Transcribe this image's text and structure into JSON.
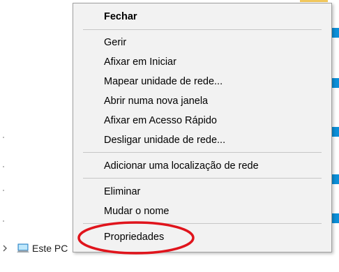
{
  "context_menu": {
    "items": [
      {
        "label": "Fechar",
        "bold": true
      },
      {
        "label": "Gerir"
      },
      {
        "label": "Afixar em Iniciar"
      },
      {
        "label": "Mapear unidade de rede..."
      },
      {
        "label": "Abrir numa nova janela"
      },
      {
        "label": "Afixar em Acesso Rápido"
      },
      {
        "label": "Desligar unidade de rede..."
      },
      {
        "label": "Adicionar uma localização de rede"
      },
      {
        "label": "Eliminar"
      },
      {
        "label": "Mudar o nome"
      },
      {
        "label": "Propriedades"
      }
    ]
  },
  "nav_tree": {
    "item_label": "Este PC"
  },
  "colors": {
    "annotation_ring": "#e0141c",
    "menu_background": "#f2f2f2",
    "accent": "#0c8fd8"
  }
}
